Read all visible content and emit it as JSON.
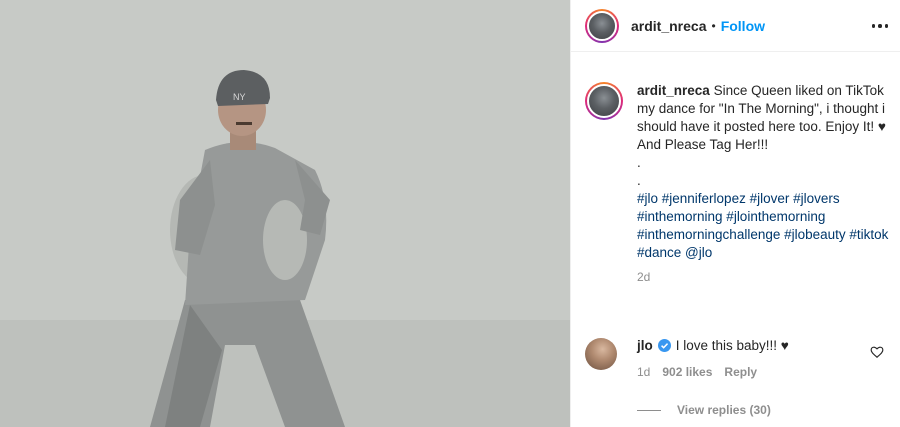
{
  "post": {
    "username": "ardit_nreca",
    "follow_label": "Follow",
    "separator": "•",
    "caption": {
      "username": "ardit_nreca",
      "text_lines": [
        "Since Queen liked on TikTok my dance for \"In The Morning\", i thought i should have it posted here too. Enjoy It! ♥",
        "And Please Tag Her!!!",
        ".",
        "."
      ],
      "hashtags": "#jlo #jenniferlopez #jlover #jlovers #inthemorning #jlointhemorning #inthemorningchallenge #jlobeauty #tiktok #dance @jlo",
      "time": "2d"
    },
    "comment": {
      "username": "jlo",
      "text": "I love this baby!!! ♥",
      "time": "1d",
      "likes": "902 likes",
      "reply_label": "Reply"
    },
    "view_replies": "View replies (30)"
  },
  "colors": {
    "link": "#0095f6",
    "hashtag": "#00376b",
    "muted": "#8e8e8e",
    "text": "#262626"
  }
}
